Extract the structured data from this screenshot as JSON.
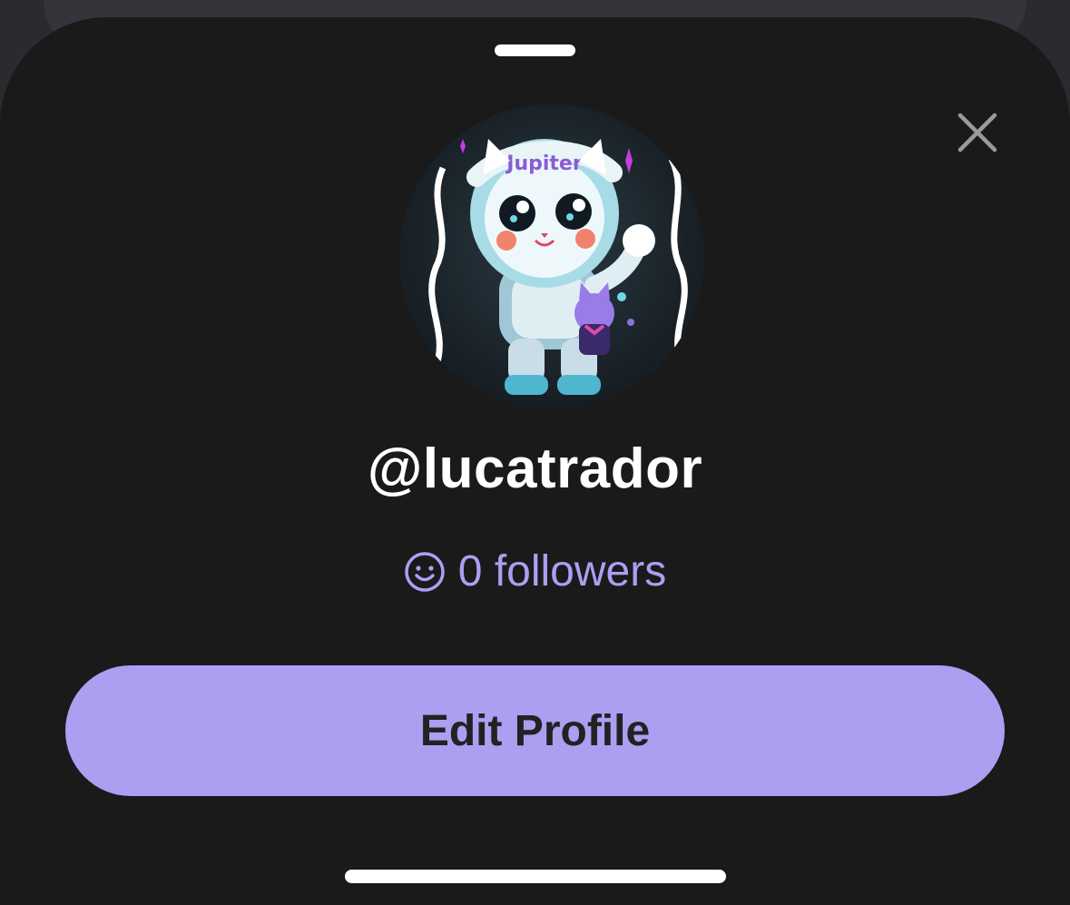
{
  "profile": {
    "username": "@lucatrador",
    "followers_text": "0 followers",
    "avatar_icon": "astronaut-cat-avatar",
    "avatar_text": "Jupiter"
  },
  "actions": {
    "edit_profile_label": "Edit Profile",
    "close_icon": "close-icon"
  },
  "colors": {
    "sheet_background": "#1a1a1b",
    "accent": "#ab9ff2",
    "button_text": "#222222"
  }
}
